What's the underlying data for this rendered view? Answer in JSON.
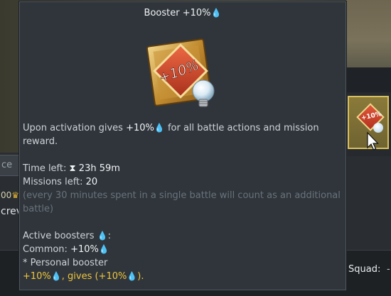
{
  "tooltip": {
    "title": "Booster +10%",
    "emblem_text": "+10%",
    "description_line1": "Upon activation gives ",
    "description_value": "+10%",
    "description_line1_rest": " for all battle actions and mission",
    "description_line2": "reward.",
    "time_left_label": "Time left: ",
    "time_left_value": "23h 59m",
    "missions_left_label": "Missions left: ",
    "missions_left_value": "20",
    "note_line1": "(every 30 minutes spent in a single battle will count as an additional",
    "note_line2": "battle)",
    "active_boosters_label": "Active boosters ",
    "active_boosters_colon": ":",
    "common_label": "Common: ",
    "common_value": "+10%",
    "personal_label": "* Personal booster",
    "personal_value": "+10%",
    "personal_gives": ", gives (",
    "personal_gives_value": "+10%",
    "personal_end": ")."
  },
  "background": {
    "left_field_text": "ce",
    "left_number": "00",
    "left_crew_text": "crev",
    "squad_label": "Squad:",
    "squad_value": "-"
  },
  "colors": {
    "tooltip_bg": "#2f353b",
    "accent_gold": "#f0c63c",
    "drop_blue": "#7fb2e5",
    "dim_text": "#6a737b"
  },
  "icons": {
    "research_points": "blue-drop-icon",
    "timer": "hourglass-icon",
    "booster": "booster-emblem-icon"
  }
}
